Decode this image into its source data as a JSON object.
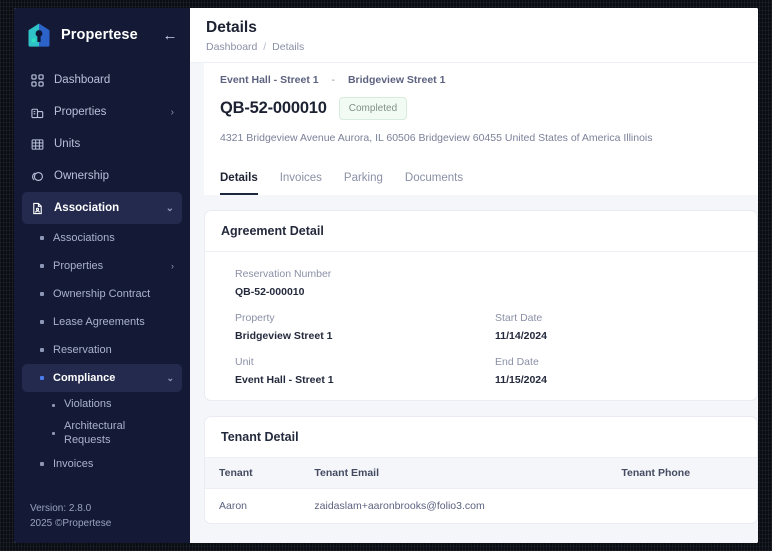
{
  "sidebar": {
    "brand": "Propertese",
    "collapse_icon": "arrow-left-icon",
    "items": [
      {
        "label": "Dashboard",
        "icon": "grid-icon",
        "chevron": "",
        "active": false
      },
      {
        "label": "Properties",
        "icon": "building-icon",
        "chevron": "›",
        "active": false
      },
      {
        "label": "Units",
        "icon": "units-grid-icon",
        "chevron": "",
        "active": false
      },
      {
        "label": "Ownership",
        "icon": "ownership-icon",
        "chevron": "",
        "active": false
      },
      {
        "label": "Association",
        "icon": "document-icon",
        "chevron": "⌄",
        "active": true
      }
    ],
    "sub_items": [
      {
        "label": "Associations",
        "chevron": "",
        "active": false
      },
      {
        "label": "Properties",
        "chevron": "›",
        "active": false
      },
      {
        "label": "Ownership Contract",
        "chevron": "",
        "active": false
      },
      {
        "label": "Lease Agreements",
        "chevron": "",
        "active": false
      },
      {
        "label": "Reservation",
        "chevron": "",
        "active": false
      },
      {
        "label": "Compliance",
        "chevron": "⌄",
        "active": true
      }
    ],
    "sub_sub_items": [
      {
        "label": "Violations"
      },
      {
        "label": "Architectural Requests"
      }
    ],
    "trailing_items": [
      {
        "label": "Invoices"
      }
    ],
    "footer_version": "Version: 2.8.0",
    "footer_copyright": "2025 ©Propertese"
  },
  "topbar": {
    "title": "Details",
    "breadcrumb_root": "Dashboard",
    "breadcrumb_sep": "/",
    "breadcrumb_current": "Details"
  },
  "detail_header": {
    "unit_name": "Event Hall - Street 1",
    "dash": "-",
    "property_name": "Bridgeview Street 1",
    "reservation_id": "QB-52-000010",
    "status_badge": "Completed",
    "address": "4321 Bridgeview Avenue Aurora, IL 60506 Bridgeview 60455 United States of America Illinois"
  },
  "tabs": [
    {
      "label": "Details",
      "active": true
    },
    {
      "label": "Invoices",
      "active": false
    },
    {
      "label": "Parking",
      "active": false
    },
    {
      "label": "Documents",
      "active": false
    }
  ],
  "agreement_detail": {
    "title": "Agreement Detail",
    "fields": [
      {
        "label": "Reservation Number",
        "value": "QB-52-000010"
      },
      {
        "label": "",
        "value": ""
      },
      {
        "label": "Property",
        "value": "Bridgeview Street 1"
      },
      {
        "label": "Start Date",
        "value": "11/14/2024"
      },
      {
        "label": "Unit",
        "value": "Event Hall - Street 1"
      },
      {
        "label": "End Date",
        "value": "11/15/2024"
      }
    ]
  },
  "tenant_detail": {
    "title": "Tenant Detail",
    "columns": [
      "Tenant",
      "Tenant Email",
      "Tenant Phone"
    ],
    "rows": [
      {
        "tenant": "Aaron",
        "email": "zaidaslam+aaronbrooks@folio3.com",
        "phone": ""
      }
    ]
  },
  "colors": {
    "sidebar_bg": "#141a36",
    "sidebar_active": "#232a4d",
    "accent_blue": "#4b7bec",
    "badge_green_bg": "#f2faf4",
    "badge_green_border": "#d7ecdd",
    "page_bg": "#f4f6fa"
  }
}
